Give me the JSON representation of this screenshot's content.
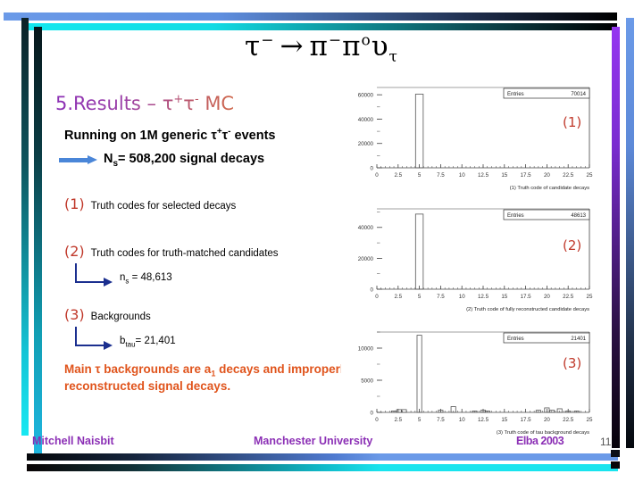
{
  "slide": {
    "formula": {
      "tau": "τ",
      "tau_sup": "−",
      "arrow": "→",
      "pi1": "π",
      "pi1_sup": "−",
      "pi2": "π",
      "pi2_sup": "o",
      "nu": "υ",
      "nu_sub": "τ"
    },
    "title_main": "5.Results – ",
    "title_tau1": "τ",
    "title_sup1": "+",
    "title_tau2": "τ",
    "title_sup2": "-",
    "title_mc": " MC",
    "running_pre": "Running on 1M generic ",
    "running_tau1": "τ",
    "running_sup1": "+",
    "running_tau2": "τ",
    "running_sup2": "-",
    "running_post": " events",
    "signal_decays": "N",
    "signal_decays_sub": "s",
    "signal_decays_rest": "= 508,200 signal decays",
    "items": [
      {
        "num": "(1)",
        "text": "Truth codes for selected decays"
      },
      {
        "num": "(2)",
        "text": "Truth codes for truth-matched candidates"
      },
      {
        "num": "(3)",
        "text": "Backgrounds"
      }
    ],
    "ns_label": "n",
    "ns_sub": "s",
    "ns_value": " = 48,613",
    "btau_label": "b",
    "btau_sub": "tau",
    "btau_value": "= 21,401",
    "conclusion_pre": "Main τ backgrounds are a",
    "conclusion_sub": "1",
    "conclusion_post": " decays and improperly reconstructed signal decays.",
    "markers": [
      "(1)",
      "(2)",
      "(3)"
    ]
  },
  "footer": {
    "author": "Mitchell Naisbit",
    "organisation": "Manchester University",
    "event": "Elba 2003",
    "page": "11"
  },
  "chart_data": [
    {
      "type": "bar",
      "id": "chart-1",
      "title": "",
      "xlabel": "(1) Truth code of candidate decays",
      "ylabel": "",
      "stats_label": "Entries",
      "stats_value": "70014",
      "xticks": [
        "0",
        "2.5",
        "5",
        "7.5",
        "10",
        "12.5",
        "15",
        "17.5",
        "20",
        "22.5",
        "25"
      ],
      "xtick_values": [
        0,
        2.5,
        5,
        7.5,
        10,
        12.5,
        15,
        17.5,
        20,
        22.5,
        25
      ],
      "yticks": [
        "0",
        "20000",
        "40000",
        "60000"
      ],
      "ytick_values": [
        0,
        20000,
        40000,
        60000
      ],
      "xlim": [
        0,
        25
      ],
      "ylim": [
        0,
        66000
      ],
      "grid": false,
      "categories": [
        5
      ],
      "values": [
        60500
      ],
      "bar_width": 0.9
    },
    {
      "type": "bar",
      "id": "chart-2",
      "title": "",
      "xlabel": "(2) Truth code of fully reconstructed candidate decays",
      "ylabel": "",
      "stats_label": "Entries",
      "stats_value": "48613",
      "xticks": [
        "0",
        "2.5",
        "5",
        "7.5",
        "10",
        "12.5",
        "15",
        "17.5",
        "20",
        "22.5",
        "25"
      ],
      "xtick_values": [
        0,
        2.5,
        5,
        7.5,
        10,
        12.5,
        15,
        17.5,
        20,
        22.5,
        25
      ],
      "yticks": [
        "0",
        "20000",
        "40000"
      ],
      "ytick_values": [
        0,
        20000,
        40000
      ],
      "xlim": [
        0,
        25
      ],
      "ylim": [
        0,
        52000
      ],
      "grid": false,
      "categories": [
        5
      ],
      "values": [
        48613
      ],
      "bar_width": 0.9
    },
    {
      "type": "bar",
      "id": "chart-3",
      "title": "",
      "xlabel": "(3) Truth code of tau background decays",
      "ylabel": "",
      "stats_label": "Entries",
      "stats_value": "21401",
      "xticks": [
        "0",
        "2.5",
        "5",
        "7.5",
        "10",
        "12.5",
        "15",
        "17.5",
        "20",
        "22.5",
        "25"
      ],
      "xtick_values": [
        0,
        2.5,
        5,
        7.5,
        10,
        12.5,
        15,
        17.5,
        20,
        22.5,
        25
      ],
      "yticks": [
        "0",
        "5000",
        "10000"
      ],
      "ytick_values": [
        0,
        5000,
        10000
      ],
      "xlim": [
        0,
        25
      ],
      "ylim": [
        0,
        12500
      ],
      "grid": false,
      "categories": [
        2,
        2.6,
        3.2,
        5,
        7.5,
        9,
        11.5,
        12.5,
        13,
        19,
        20,
        20.6,
        21.5,
        22.5,
        23.5
      ],
      "values": [
        220,
        430,
        430,
        12000,
        330,
        900,
        220,
        330,
        220,
        330,
        700,
        330,
        560,
        220,
        220
      ],
      "bar_width": 0.55
    }
  ]
}
